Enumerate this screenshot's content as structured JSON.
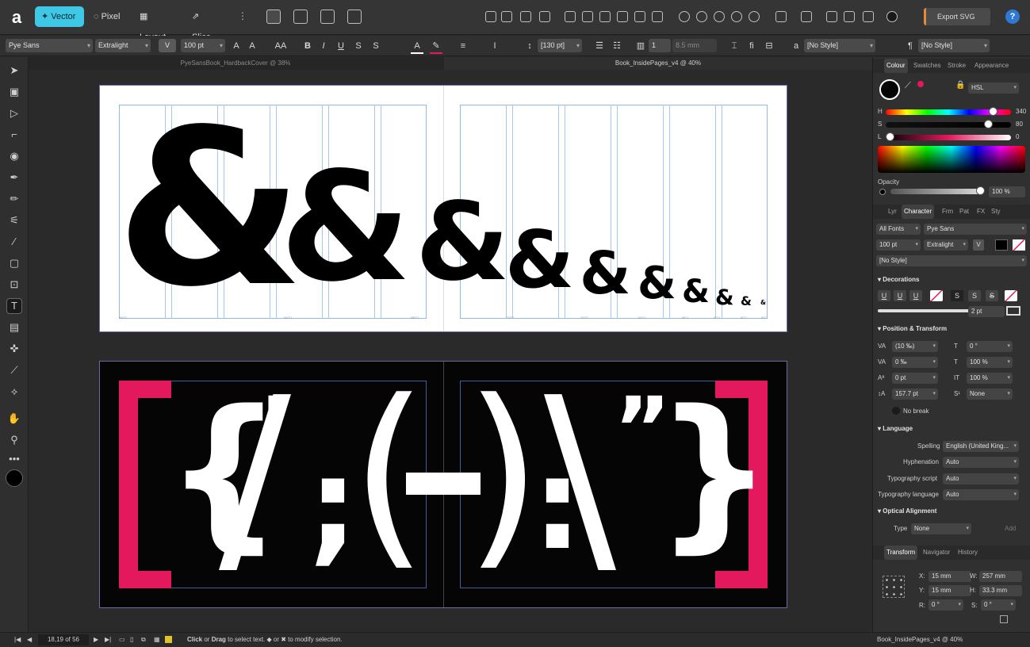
{
  "toolbar": {
    "logo": "a",
    "personas": [
      "Vector",
      "Pixel",
      "Layout",
      "Slice"
    ],
    "export_label": "Export SVG",
    "help": "?"
  },
  "context": {
    "font_family": "Pye Sans",
    "font_style": "Extralight",
    "font_size": "100 pt",
    "leading": "[130 pt]",
    "columns": "1",
    "gutter": "8.5 mm",
    "para_style": "[No Style]",
    "char_style": "[No Style]",
    "bold": "B",
    "italic": "I",
    "underline": "U",
    "strike": "S",
    "caps": "AA"
  },
  "tabs": [
    "PyeSansBook_HardbackCover @ 38%",
    "Book_InsidePages_v4 @ 40%"
  ],
  "spreads": {
    "amp_glyph": "&",
    "top_ticks": [
      "960°1",
      "540°1",
      "980°1",
      "270°1",
      "200°1",
      "160°1",
      "98°1",
      "90°1",
      "60°1",
      "50°1"
    ],
    "bottom_glyphs_left": [
      "[",
      "{",
      "'",
      "/",
      ":",
      ";",
      "("
    ],
    "bottom_glyphs_right": [
      ")",
      ":",
      "\\",
      "”",
      "}",
      "]"
    ],
    "dash": "-",
    "accent": "#e4185c"
  },
  "right": {
    "colour_tabs": [
      "Colour",
      "Swatches",
      "Stroke",
      "Appearance"
    ],
    "color_model": "HSL",
    "h_label": "H",
    "h_value": "340",
    "s_label": "S",
    "s_value": "80",
    "l_label": "L",
    "l_value": "0",
    "opacity_label": "Opacity",
    "opacity_value": "100 %",
    "char_tabs": [
      "Lyr",
      "Character",
      "Frm",
      "Pat",
      "FX",
      "Sty"
    ],
    "all_fonts": "All Fonts",
    "font": "Pye Sans",
    "size": "100 pt",
    "weight": "Extralight",
    "style": "[No Style]",
    "decorations_title": "Decorations",
    "decoration_glyphs": [
      "U",
      "U",
      "U",
      "S",
      "S",
      "S"
    ],
    "stroke_value": "2 pt",
    "pos_title": "Position & Transform",
    "tracking": "(10 ‰)",
    "kerning": "0 ‰",
    "baseline": "0 pt",
    "size2": "157.7 pt",
    "skew": "0 °",
    "hscale": "100 %",
    "vscale": "100 %",
    "script": "None",
    "no_break": "No break",
    "language_title": "Language",
    "spelling_label": "Spelling",
    "spelling_value": "English (United King...",
    "hyphenation_label": "Hyphenation",
    "hyphenation_value": "Auto",
    "typo_script_label": "Typography script",
    "typo_script_value": "Auto",
    "typo_lang_label": "Typography language",
    "typo_lang_value": "Auto",
    "optical_title": "Optical Alignment",
    "type_label": "Type",
    "type_value": "None",
    "add_label": "Add",
    "transform_tabs": [
      "Transform",
      "Navigator",
      "History"
    ],
    "x_label": "X:",
    "x_value": "15 mm",
    "y_label": "Y:",
    "y_value": "15 mm",
    "w_label": "W:",
    "w_value": "257 mm",
    "h2_label": "H:",
    "h2_value": "33.3 mm",
    "r_label": "R:",
    "r_value": "0 °",
    "s2_label": "S:",
    "s2_value": "0 °"
  },
  "status": {
    "page": "18,19 of 56",
    "hint_click": "Click",
    "hint_or": " or ",
    "hint_drag": "Drag",
    "hint_rest": " to select text. ◆ or ✖ to modify selection.",
    "doc_name": "Book_InsidePages_v4 @ 40%"
  }
}
